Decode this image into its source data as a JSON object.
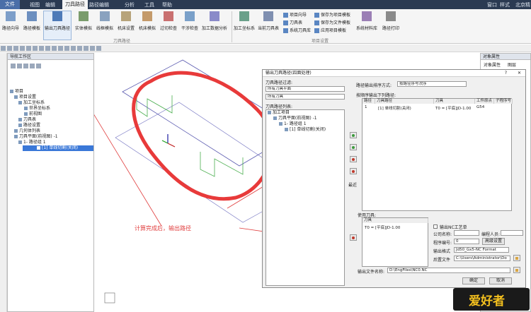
{
  "title_bar": {
    "file_tab": "文件",
    "tabs": [
      "视图",
      "编辑",
      "刀具路径",
      "路径编辑",
      "分析",
      "工具",
      "帮助"
    ],
    "window_menu": "窗口",
    "style_menu": "样式",
    "brand": "北京精"
  },
  "ribbon": {
    "buttons": [
      "路径向导",
      "路径模板",
      "输出刀具路径",
      "实体模拟",
      "线框模拟",
      "机床设置",
      "机床模拟",
      "过切检查",
      "干涉检查",
      "加工数据分析",
      "加工坐标系",
      "当前刀具表",
      "系统材料库",
      "路径打印"
    ],
    "small_items": [
      "项目向导",
      "保存为项目模板",
      "刀具表",
      "保存为文件模板",
      "系统刀具库",
      "应用项目模板"
    ],
    "groups": [
      "刀具路径",
      "项目设置"
    ]
  },
  "nav_panel": {
    "title": "导航工作区",
    "tree": [
      "项目",
      "项目设置",
      "加工坐标系",
      "世界坐标系",
      "前视图",
      "刀具表",
      "路径设置",
      "几何体列表",
      "刀具平面(前视图) -1",
      "1- 路径组 1",
      "[1] 单线切割(关闭)"
    ]
  },
  "attr_panel": {
    "title": "对象属性",
    "tabs": [
      "对象属性",
      "图层"
    ]
  },
  "dialog": {
    "title": "输出刀具路径(四面处理)",
    "filter_label": "刀具路径过滤:",
    "filter_value_1": "所有刀具平面",
    "filter_value_2": "所有刀具",
    "list_label": "刀具路径列表:",
    "list_tree": [
      "加工项目",
      "刀具平面(前视图) -1",
      "1- 路径组 1",
      "[1] 单线切割(关闭)"
    ],
    "sort_label": "路径输出排序方式:",
    "sort_value": "按路径序号次序",
    "output_list_label": "按顺序输出下列路径:",
    "table_headers": [
      "路径",
      "刀具路径",
      "刀具",
      "工件原点",
      "子程序号"
    ],
    "table_row": {
      "seq": "1",
      "path": "[1] 单线切割(关闭)",
      "tool": "T0 = [平底]JD-1.00",
      "origin": "G54",
      "sub": ""
    },
    "move_label": "最近",
    "used_tools_label": "使用刀具:",
    "tools_header": "刀具",
    "tool_item": "T0 = [平底]JD-1.00",
    "checkbox_label": "输出NC工艺单",
    "company_label": "公司名称:",
    "programmer_label": "编程人员:",
    "program_no_label": "程序编号:",
    "program_no_value": "0",
    "advanced_button": "高级设置",
    "format_label": "输出格式",
    "format_value": "Jd50_Gx5-NC Format",
    "postfile_label": "后置文件",
    "postfile_value": "C:\\Users\\Administrator\\Do",
    "output_file_label": "输出文件名称:",
    "output_file_value": "D:\\EngFiles\\NC0.NC",
    "ok_button": "确定",
    "cancel_button": "取消"
  },
  "annotation": "计算完成后，输出路径",
  "watermark": "爱好者",
  "colors": {
    "title_bar": "#2b3a52",
    "highlight_circle": "#e83a3a",
    "annotation": "#e03c3c",
    "selection": "#3a78d8"
  }
}
